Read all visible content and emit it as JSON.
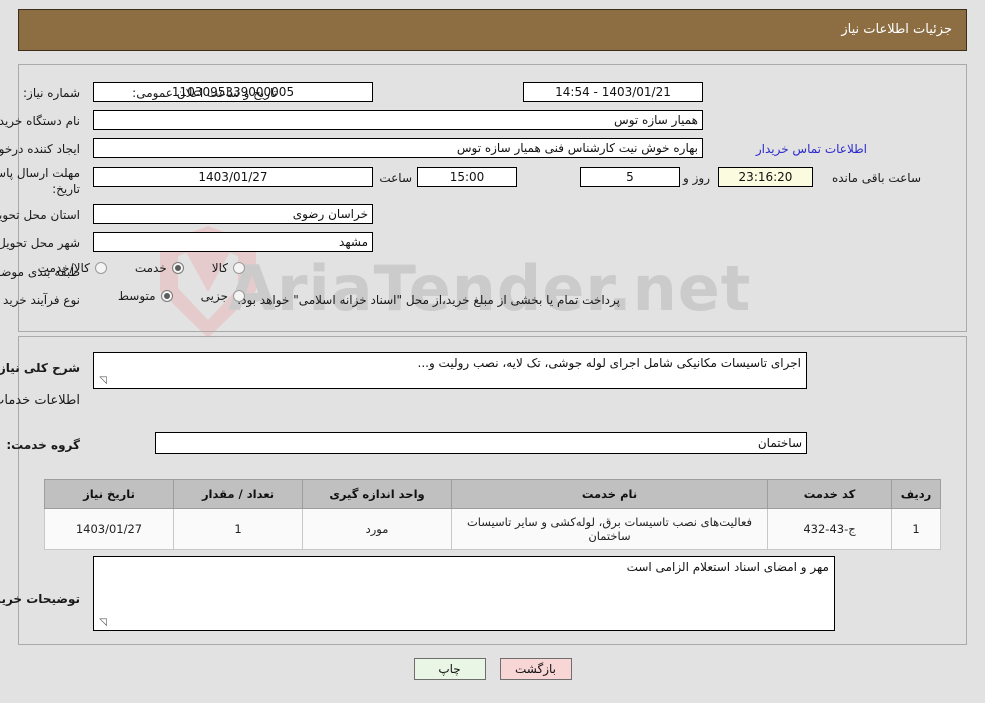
{
  "header": {
    "title": "جزئیات اطلاعات نیاز"
  },
  "watermark": {
    "text": "AriaTender.net"
  },
  "top_form": {
    "need_number": {
      "label": "شماره نیاز:",
      "value": "1103095339000005"
    },
    "announce": {
      "label": "تاریخ و ساعت اعلان عمومی:",
      "value": "1403/01/21 - 14:54"
    },
    "buyer_org": {
      "label": "نام دستگاه خریدار:",
      "value": "همیار سازه توس"
    },
    "requester": {
      "label": "ایجاد کننده درخواست:",
      "value": "بهاره خوش نیت کارشناس فنی همیار سازه توس"
    },
    "contact_link": "اطلاعات تماس خریدار",
    "deadline": {
      "label_line1": "مهلت ارسال پاسخ: تا",
      "label_line2": "تاریخ:",
      "date": "1403/01/27",
      "time_label": "ساعت",
      "time": "15:00",
      "days": "5",
      "days_label": "روز و",
      "countdown": "23:16:20",
      "countdown_label": "ساعت باقی مانده"
    },
    "province": {
      "label": "استان محل تحویل:",
      "value": "خراسان رضوی"
    },
    "city": {
      "label": "شهر محل تحویل:",
      "value": "مشهد"
    },
    "category": {
      "label": "طبقه بندی موضوعی:",
      "options": [
        {
          "label": "کالا",
          "selected": false
        },
        {
          "label": "خدمت",
          "selected": true
        },
        {
          "label": "کالا/خدمت",
          "selected": false
        }
      ]
    },
    "purchase_type": {
      "label": "نوع فرآیند خرید :",
      "options": [
        {
          "label": "جزیی",
          "selected": false
        },
        {
          "label": "متوسط",
          "selected": true
        }
      ],
      "note": "پرداخت تمام یا بخشی از مبلغ خرید،از محل \"اسناد خزانه اسلامی\" خواهد بود."
    }
  },
  "mid_form": {
    "general_desc": {
      "label": "شرح کلی نیاز:",
      "value": "اجرای تاسیسات مکانیکی شامل اجرای لوله جوشی، تک لایه، نصب رولیت و..."
    },
    "section_heading": "اطلاعات خدمات مورد نیاز",
    "service_group": {
      "label": "گروه خدمت:",
      "value": "ساختمان"
    },
    "table": {
      "columns": [
        "ردیف",
        "کد خدمت",
        "نام خدمت",
        "واحد اندازه گیری",
        "تعداد / مقدار",
        "تاریخ نیاز"
      ],
      "rows": [
        {
          "row": "1",
          "code": "ج-43-432",
          "name": "فعالیت‌های نصب تاسیسات برق، لوله‌کشی و سایر تاسیسات ساختمان",
          "unit": "مورد",
          "qty": "1",
          "date": "1403/01/27"
        }
      ]
    },
    "buyer_notes": {
      "label": "توضیحات خریدار:",
      "value": "مهر و امضای اسناد استعلام الزامی است"
    }
  },
  "buttons": {
    "print": "چاپ",
    "back": "بازگشت"
  }
}
